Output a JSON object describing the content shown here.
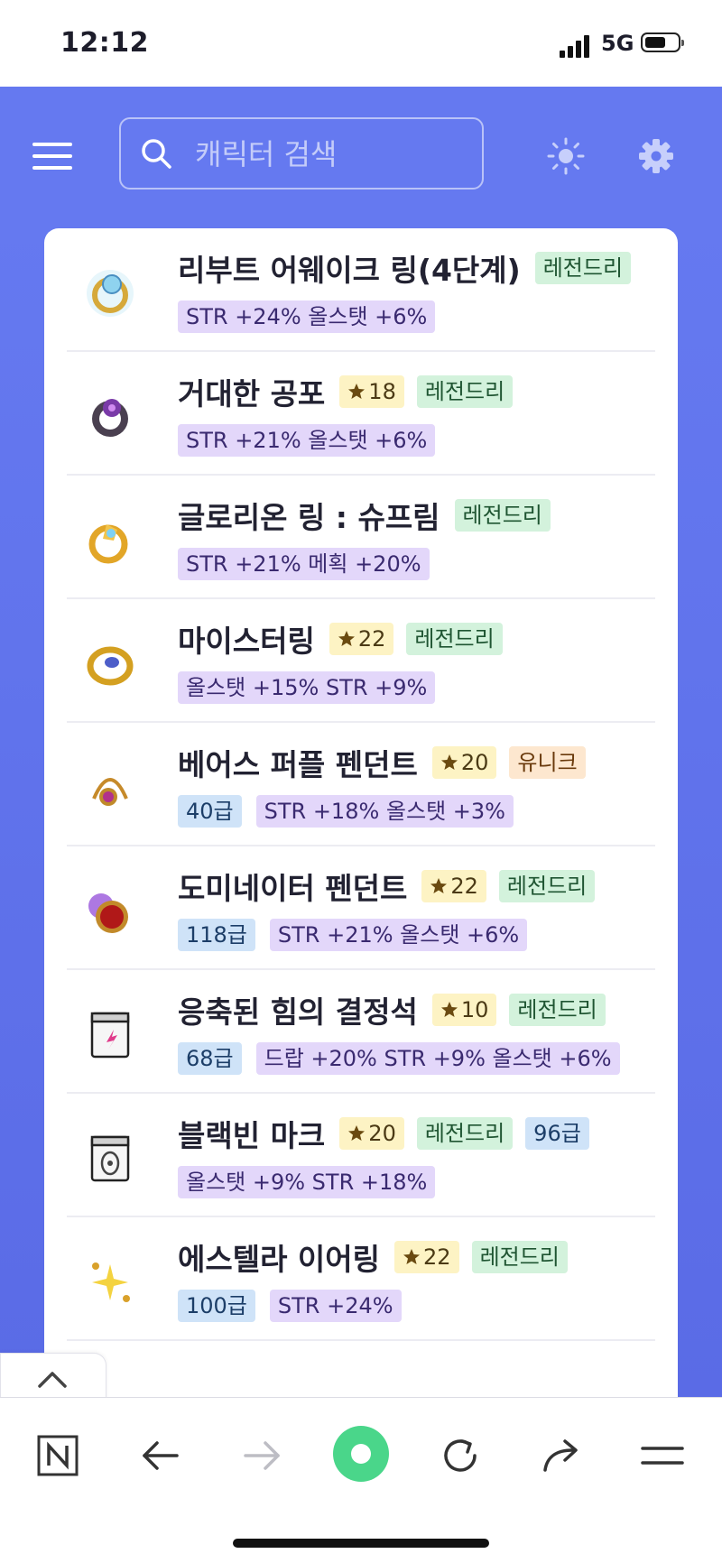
{
  "status_bar": {
    "time": "12:12",
    "network": "5G",
    "battery_level": 0.55
  },
  "header": {
    "search": {
      "placeholder": "캐릭터 검색"
    }
  },
  "items": [
    {
      "name": "리부트 어웨이크 링(4단계)",
      "icon": "awake-ring-icon",
      "star": null,
      "grade": "레전드리",
      "grade_type": "legendary",
      "level": null,
      "stats": [
        "STR +24% 올스탯 +6%"
      ]
    },
    {
      "name": "거대한 공포",
      "icon": "giant-terror-ring-icon",
      "star": "18",
      "grade": "레전드리",
      "grade_type": "legendary",
      "level": null,
      "stats": [
        "STR +21% 올스탯 +6%"
      ]
    },
    {
      "name": "글로리온 링 : 슈프림",
      "icon": "glorion-ring-icon",
      "star": null,
      "grade": "레전드리",
      "grade_type": "legendary",
      "level": null,
      "stats": [
        "STR +21% 메획 +20%"
      ]
    },
    {
      "name": "마이스터링",
      "icon": "meister-ring-icon",
      "star": "22",
      "grade": "레전드리",
      "grade_type": "legendary",
      "level": null,
      "stats": [
        "올스탯 +15% STR +9%"
      ]
    },
    {
      "name": "베어스 퍼플 펜던트",
      "icon": "purple-pendant-icon",
      "star": "20",
      "grade": "유니크",
      "grade_type": "unique",
      "level": "40급",
      "stats": [
        "STR +18% 올스탯 +3%"
      ]
    },
    {
      "name": "도미네이터 펜던트",
      "icon": "dominator-pendant-icon",
      "star": "22",
      "grade": "레전드리",
      "grade_type": "legendary",
      "level": "118급",
      "stats": [
        "STR +21% 올스탯 +6%"
      ]
    },
    {
      "name": "응축된 힘의 결정석",
      "icon": "crystal-badge-icon",
      "star": "10",
      "grade": "레전드리",
      "grade_type": "legendary",
      "level": "68급",
      "stats": [
        "드랍 +20% STR +9% 올스탯 +6%"
      ]
    },
    {
      "name": "블랙빈 마크",
      "icon": "blackbean-mark-icon",
      "star": "20",
      "grade": "레전드리",
      "grade_type": "legendary",
      "level_inline": "96급",
      "level": null,
      "stats": [
        "올스탯 +9% STR +18%"
      ]
    },
    {
      "name": "에스텔라 이어링",
      "icon": "estella-earring-icon",
      "star": "22",
      "grade": "레전드리",
      "grade_type": "legendary",
      "level": "100급",
      "stats": [
        "STR +24%"
      ]
    }
  ],
  "colors": {
    "header_bg": "#6579f0",
    "legendary_bg": "#d3f2dc",
    "unique_bg": "#fde7cf",
    "star_bg": "#fdf3c4",
    "level_bg": "#cfe3f8",
    "stat_bg": "#e3d7fa",
    "home_dot": "#4ad68a"
  }
}
